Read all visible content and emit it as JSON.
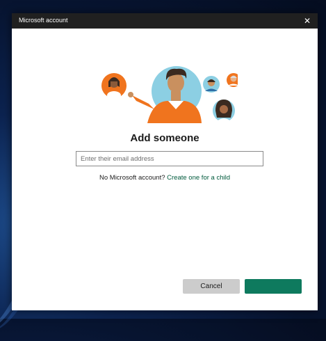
{
  "window": {
    "title": "Microsoft account",
    "close_icon": "close-icon"
  },
  "heading": "Add someone",
  "email": {
    "placeholder": "Enter their email address",
    "value": ""
  },
  "no_account": {
    "text": "No Microsoft account?",
    "link": "Create one for a child"
  },
  "buttons": {
    "cancel": "Cancel",
    "next": ""
  },
  "colors": {
    "accent": "#0e7a5e",
    "link": "#005a3c",
    "illustration_orange": "#f0741e",
    "illustration_blue": "#8ccfe3"
  }
}
